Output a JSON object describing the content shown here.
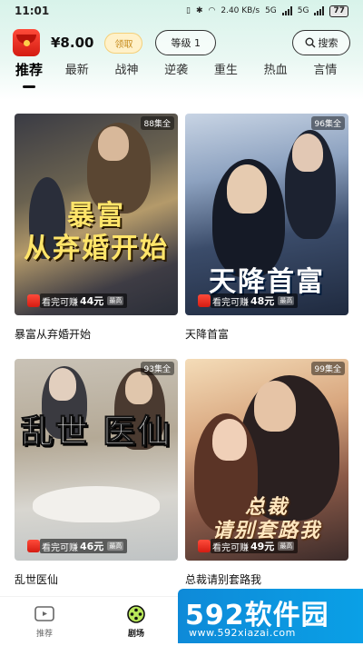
{
  "status": {
    "time": "11:01",
    "speed": "2.40 KB/s",
    "net1": "5G",
    "net2": "5G",
    "battery": "77"
  },
  "header": {
    "balance": "¥8.00",
    "claim_label": "领取",
    "level_label": "等级 1",
    "search_label": "搜索"
  },
  "tabs": [
    "推荐",
    "最新",
    "战神",
    "逆袭",
    "重生",
    "热血",
    "言情"
  ],
  "cards": [
    {
      "title": "暴富从弃婚开始",
      "poster_title": "暴富\n从弃婚开始",
      "episodes": "88集全",
      "earn_text": "看完可赚",
      "earn_amount": "44元",
      "earn_tag": "最高"
    },
    {
      "title": "天降首富",
      "poster_title": "天降首富",
      "episodes": "96集全",
      "earn_text": "看完可赚",
      "earn_amount": "48元",
      "earn_tag": "最高"
    },
    {
      "title": "乱世医仙",
      "poster_title": "乱世医仙",
      "episodes": "93集全",
      "earn_text": "看完可赚",
      "earn_amount": "46元",
      "earn_tag": "最高"
    },
    {
      "title": "总裁请别套路我",
      "poster_title": "总裁请别套路我",
      "episodes": "99集全",
      "earn_text": "看完可赚",
      "earn_amount": "49元",
      "earn_tag": "最高"
    }
  ],
  "nav": {
    "home_label": "推荐",
    "theater_label": "剧场"
  },
  "watermark": {
    "brand": "592软件园",
    "url": "www.592xiazai.com"
  },
  "colors": {
    "accent_bg": "#d8f3ea",
    "red": "#e52b1f",
    "watermark_blue": "#0e8ad8",
    "watermark_orange": "#ff7a1a"
  }
}
